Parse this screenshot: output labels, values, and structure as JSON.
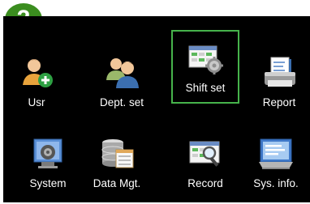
{
  "badge": {
    "number": "2",
    "color": "#3b8d1f"
  },
  "menu": {
    "selected_color": "#46b34b",
    "items": [
      {
        "label": "Usr",
        "icon": "add-user-icon",
        "selected": false
      },
      {
        "label": "Dept. set",
        "icon": "department-icon",
        "selected": false
      },
      {
        "label": "Shift set",
        "icon": "shift-schedule-icon",
        "selected": true
      },
      {
        "label": "Report",
        "icon": "report-printer-icon",
        "selected": false
      },
      {
        "label": "System",
        "icon": "system-settings-icon",
        "selected": false
      },
      {
        "label": "Data Mgt.",
        "icon": "database-icon",
        "selected": false
      },
      {
        "label": "Record",
        "icon": "record-search-icon",
        "selected": false
      },
      {
        "label": "Sys. info.",
        "icon": "system-info-icon",
        "selected": false
      }
    ]
  }
}
